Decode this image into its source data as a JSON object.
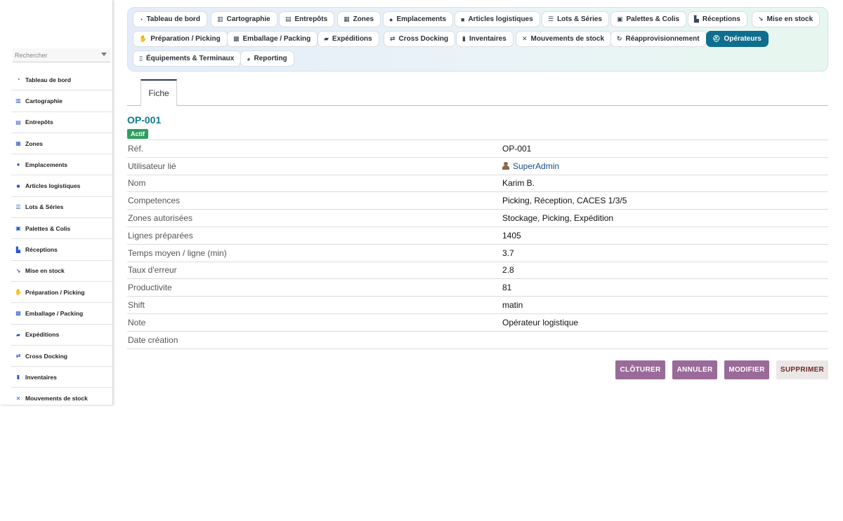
{
  "sidebar": {
    "search_placeholder": "Rechercher",
    "items": [
      {
        "label": "Tableau de bord",
        "icon": "dashboard-icon"
      },
      {
        "label": "Cartographie",
        "icon": "map-icon"
      },
      {
        "label": "Entrepôts",
        "icon": "warehouse-icon"
      },
      {
        "label": "Zones",
        "icon": "grid-icon"
      },
      {
        "label": "Emplacements",
        "icon": "map-pin-icon"
      },
      {
        "label": "Articles logistiques",
        "icon": "box-icon"
      },
      {
        "label": "Lots & Séries",
        "icon": "list-icon"
      },
      {
        "label": "Palettes & Colis",
        "icon": "pallet-icon"
      },
      {
        "label": "Réceptions",
        "icon": "truck-loading-icon"
      },
      {
        "label": "Mise en stock",
        "icon": "dolly-icon"
      },
      {
        "label": "Préparation / Picking",
        "icon": "hand-icon"
      },
      {
        "label": "Emballage / Packing",
        "icon": "boxes-icon"
      },
      {
        "label": "Expéditions",
        "icon": "truck-icon"
      },
      {
        "label": "Cross Docking",
        "icon": "exchange-icon"
      },
      {
        "label": "Inventaires",
        "icon": "clipboard-icon"
      },
      {
        "label": "Mouvements de stock",
        "icon": "shuffle-icon"
      }
    ]
  },
  "topbar": {
    "modules": [
      "Tableau de bord",
      "Cartographie",
      "Entrepôts",
      "Zones",
      "Emplacements",
      "Articles logistiques",
      "Lots & Séries",
      "Palettes & Colis",
      "Réceptions",
      "Mise en stock",
      "Préparation / Picking",
      "Emballage / Packing",
      "Expéditions",
      "Cross Docking",
      "Inventaires",
      "Mouvements de stock",
      "Réapprovisionnement",
      "Opérateurs",
      "Équipements & Terminaux",
      "Reporting"
    ],
    "active": "Opérateurs"
  },
  "tab": {
    "label": "Fiche"
  },
  "record": {
    "title": "OP-001",
    "status": "Actif",
    "fields": [
      {
        "label": "Réf.",
        "value": "OP-001"
      },
      {
        "label": "Utilisateur lié",
        "value": "SuperAdmin"
      },
      {
        "label": "Nom",
        "value": "Karim B."
      },
      {
        "label": "Competences",
        "value": "Picking, Réception, CACES 1/3/5"
      },
      {
        "label": "Zones autorisées",
        "value": "Stockage, Picking, Expédition"
      },
      {
        "label": "Lignes préparées",
        "value": "1405"
      },
      {
        "label": "Temps moyen / ligne (min)",
        "value": "3.7"
      },
      {
        "label": "Taux d'erreur",
        "value": "2.8"
      },
      {
        "label": "Productivite",
        "value": "81"
      },
      {
        "label": "Shift",
        "value": "matin"
      },
      {
        "label": "Note",
        "value": "Opérateur logistique"
      },
      {
        "label": "Date création",
        "value": ""
      }
    ]
  },
  "actions": {
    "close": "CLÔTURER",
    "cancel": "ANNULER",
    "edit": "MODIFIER",
    "delete": "SUPPRIMER"
  },
  "colors": {
    "accent": "#0f6e8e",
    "title": "#0f7a8c",
    "status_badge": "#2e9e5f",
    "action_button": "#9a6a99",
    "sidebar_icon": "#2a57c9"
  }
}
